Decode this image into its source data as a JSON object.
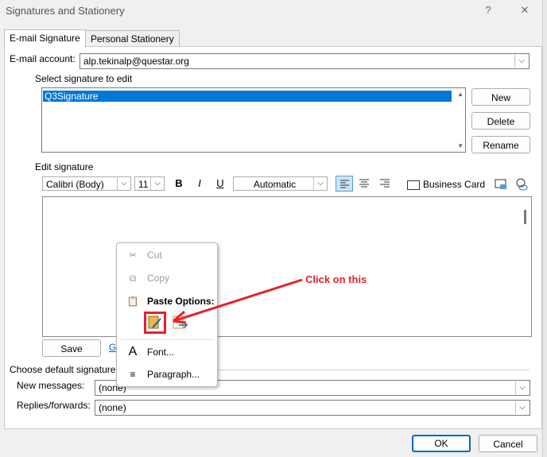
{
  "window": {
    "title": "Signatures and Stationery",
    "help": "?",
    "close": "✕"
  },
  "tabs": [
    {
      "label": "E-mail Signature"
    },
    {
      "label": "Personal Stationery"
    }
  ],
  "email_account": {
    "label": "E-mail account:",
    "value": "alp.tekinalp@questar.org"
  },
  "select_signature": {
    "label": "Select signature to edit",
    "items": [
      "Q3Signature"
    ]
  },
  "side_buttons": {
    "new": "New",
    "delete": "Delete",
    "rename": "Rename"
  },
  "edit_signature": {
    "label": "Edit signature"
  },
  "toolbar": {
    "font": "Calibri (Body)",
    "size": "11",
    "bold": "B",
    "italic": "I",
    "underline": "U",
    "color": "Automatic",
    "business_card": "Business Card"
  },
  "bottom_buttons": {
    "save": "Save",
    "partial": "G"
  },
  "defaults": {
    "label": "Choose default signature",
    "new_messages_label": "New messages:",
    "new_messages_value": "(none)",
    "replies_label": "Replies/forwards:",
    "replies_value": "(none)"
  },
  "dialog_buttons": {
    "ok": "OK",
    "cancel": "Cancel"
  },
  "context_menu": {
    "cut": "Cut",
    "copy": "Copy",
    "paste_options": "Paste Options:",
    "font": "Font...",
    "paragraph": "Paragraph..."
  },
  "annotation": {
    "text": "Click on this",
    "color": "#e8202a"
  }
}
